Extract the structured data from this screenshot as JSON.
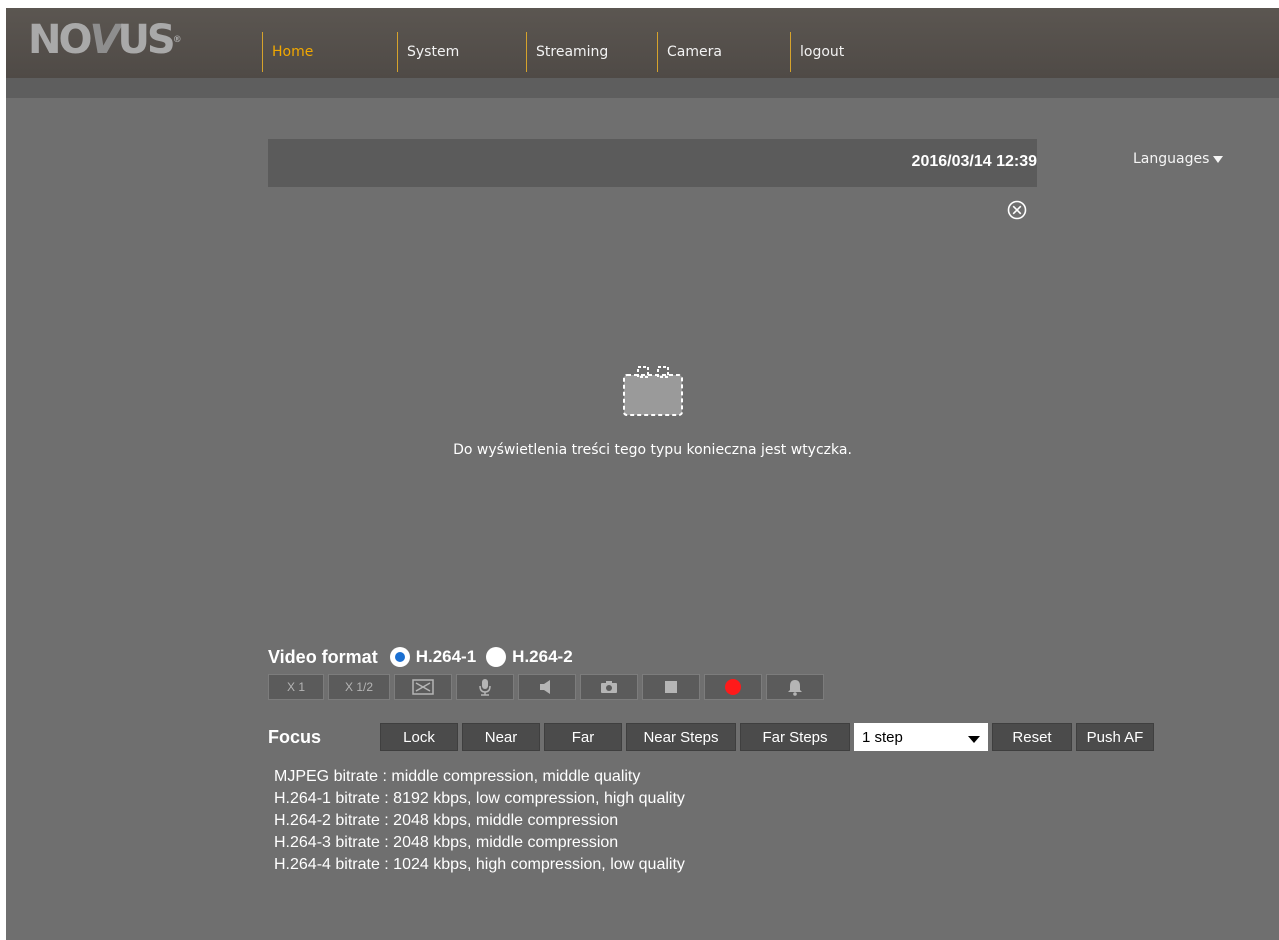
{
  "brand": {
    "logo_text": "NOVUS"
  },
  "nav": {
    "items": [
      {
        "label": "Home",
        "active": true
      },
      {
        "label": "System",
        "active": false
      },
      {
        "label": "Streaming",
        "active": false
      },
      {
        "label": "Camera",
        "active": false
      },
      {
        "label": "logout",
        "active": false
      }
    ]
  },
  "languages": {
    "label": "Languages"
  },
  "video": {
    "datetime": "2016/03/14 12:39",
    "plugin_message": "Do wyświetlenia treści tego typu konieczna jest wtyczka."
  },
  "video_format": {
    "label": "Video format",
    "options": [
      {
        "label": "H.264-1",
        "selected": true
      },
      {
        "label": "H.264-2",
        "selected": false
      }
    ]
  },
  "controls": {
    "zoom_x1": "X 1",
    "zoom_x12": "X 1/2",
    "icons": [
      "fullscreen-icon",
      "microphone-icon",
      "speaker-icon",
      "snapshot-camera-icon",
      "stop-icon",
      "record-icon",
      "alarm-bell-icon"
    ],
    "record_color": "#ff1a1a"
  },
  "focus": {
    "label": "Focus",
    "buttons": {
      "lock": "Lock",
      "near": "Near",
      "far": "Far",
      "near_steps": "Near Steps",
      "far_steps": "Far Steps",
      "reset": "Reset",
      "push_af": "Push AF"
    },
    "step_select": {
      "value": "1 step"
    }
  },
  "bitrates": [
    "MJPEG bitrate : middle compression, middle quality",
    "H.264-1 bitrate : 8192 kbps, low compression, high quality",
    "H.264-2 bitrate : 2048 kbps, middle compression",
    "H.264-3 bitrate : 2048 kbps, middle compression",
    "H.264-4 bitrate : 1024 kbps, high compression, low quality"
  ],
  "colors": {
    "nav_active": "#f1a800",
    "nav_separator": "#d6a32c",
    "radio_selected": "#1b6fd1"
  }
}
